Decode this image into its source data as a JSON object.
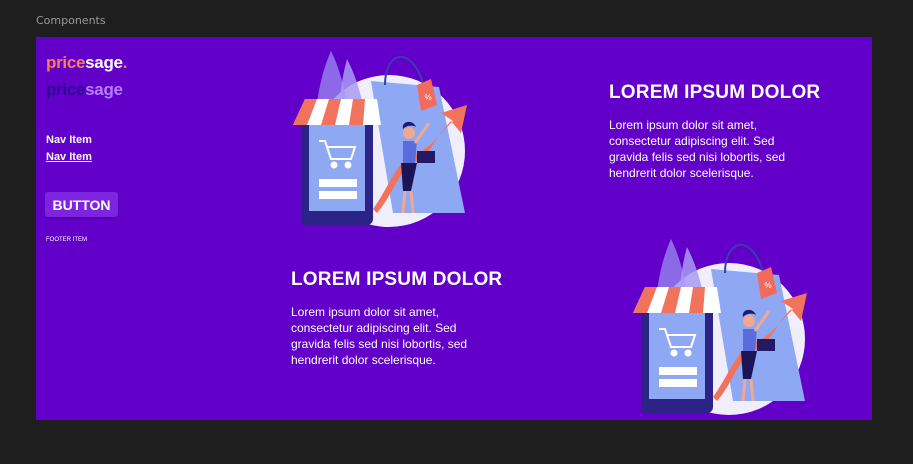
{
  "canvas": {
    "frame_label": "Components"
  },
  "brand": {
    "logo_light": {
      "part1": "price",
      "part2": "sage",
      "dot": "."
    },
    "logo_dark": {
      "part1": "price",
      "part2": "sage",
      "dot": "."
    },
    "colors": {
      "background": "#6200c9",
      "accent": "#ff7a59",
      "button": "#7d24e0"
    }
  },
  "nav": {
    "items": [
      {
        "label": "Nav Item"
      },
      {
        "label": "Nav Item"
      }
    ]
  },
  "button": {
    "label": "BUTTON"
  },
  "footer": {
    "item": "FOOTER ITEM"
  },
  "sections": [
    {
      "title": "LOREM IPSUM DOLOR",
      "body": "Lorem ipsum dolor sit amet, consectetur adipiscing elit. Sed gravida felis sed nisi lobortis, sed hendrerit dolor scelerisque.",
      "illustration_tag": "%"
    },
    {
      "title": "LOREM IPSUM DOLOR",
      "body": "Lorem ipsum dolor sit amet, consectetur adipiscing elit. Sed gravida felis sed nisi lobortis, sed hendrerit dolor scelerisque.",
      "illustration_tag": "%"
    }
  ]
}
